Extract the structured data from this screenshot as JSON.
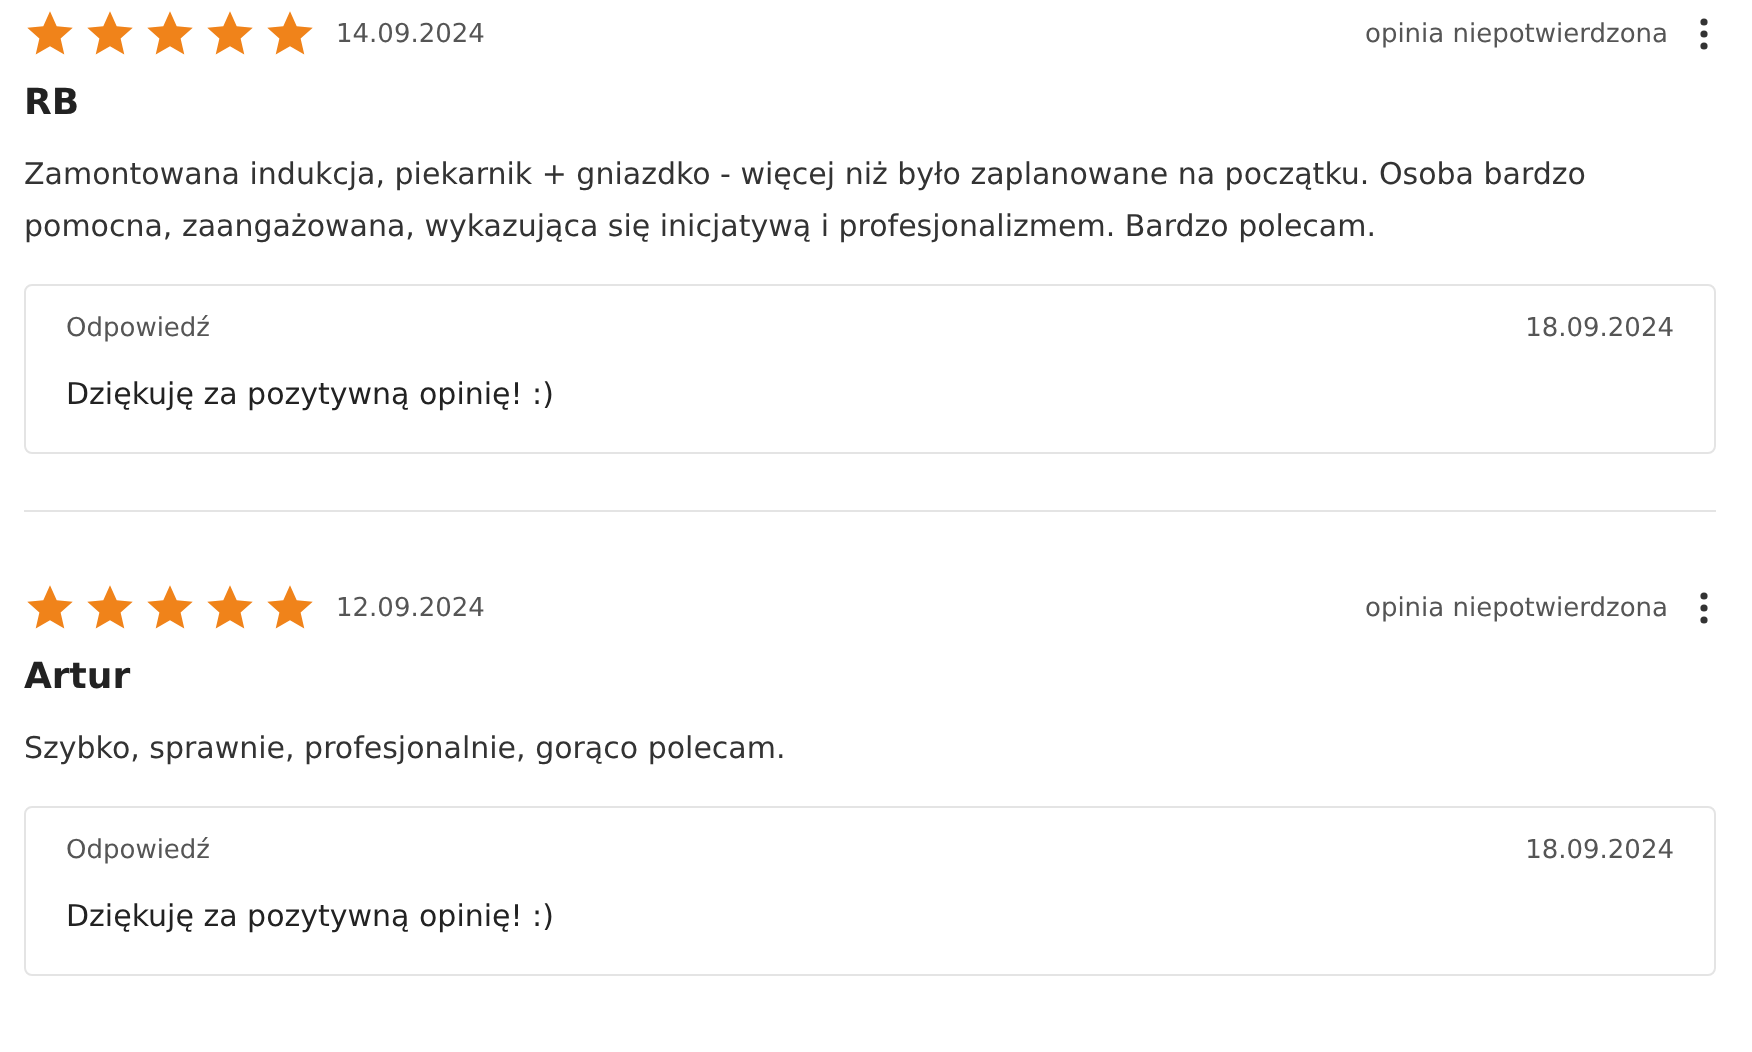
{
  "reviews": [
    {
      "stars": 5,
      "date": "14.09.2024",
      "status": "opinia niepotwierdzona",
      "author": "RB",
      "text": "Zamontowana indukcja, piekarnik + gniazdko - więcej niż było zaplanowane na początku. Osoba bardzo pomocna, zaangażowana, wykazująca się inicjatywą i profesjonalizmem. Bardzo polecam.",
      "reply": {
        "label": "Odpowiedź",
        "date": "18.09.2024",
        "text": "Dziękuję za pozytywną opinię! :)"
      }
    },
    {
      "stars": 5,
      "date": "12.09.2024",
      "status": "opinia niepotwierdzona",
      "author": "Artur",
      "text": "Szybko, sprawnie, profesjonalnie, gorąco polecam.",
      "reply": {
        "label": "Odpowiedź",
        "date": "18.09.2024",
        "text": "Dziękuję za pozytywną opinię! :)"
      }
    }
  ]
}
